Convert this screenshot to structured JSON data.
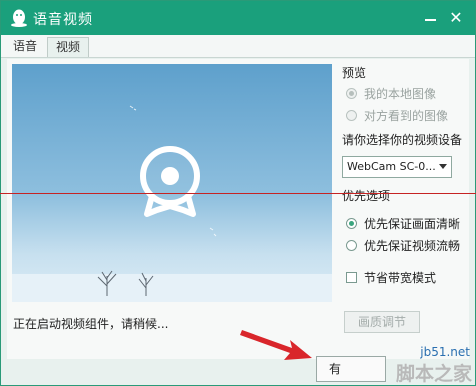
{
  "window": {
    "title": "语音视频",
    "colors": {
      "titlebar": "#1aa07c",
      "accent_radio": "#3aa57e"
    }
  },
  "tabs": [
    {
      "label": "语音",
      "selected": false
    },
    {
      "label": "视频",
      "selected": true
    }
  ],
  "video": {
    "status": "正在启动视频组件，请稍候..."
  },
  "side": {
    "preview_heading": "预览",
    "preview_options": [
      {
        "label": "我的本地图像",
        "checked": true,
        "disabled": true
      },
      {
        "label": "对方看到的图像",
        "checked": false,
        "disabled": true
      }
    ],
    "device_prompt": "请你选择你的视频设备",
    "device_selected": "WebCam SC-0...",
    "priority_heading": "优先选项",
    "priority_options": [
      {
        "label": "优先保证画面清晰",
        "checked": true
      },
      {
        "label": "优先保证视频流畅",
        "checked": false
      }
    ],
    "bandwidth_checkbox": {
      "label": "节省带宽模式",
      "checked": false
    },
    "quality_button": "画质调节"
  },
  "bottom_button_label": "有",
  "watermark": {
    "site": "jb51.net",
    "name": "脚本之家"
  },
  "icons": [
    "qq-penguin-icon",
    "minimize-icon",
    "close-icon",
    "webcam-icon",
    "dropdown-arrow-icon",
    "red-arrow-icon"
  ]
}
